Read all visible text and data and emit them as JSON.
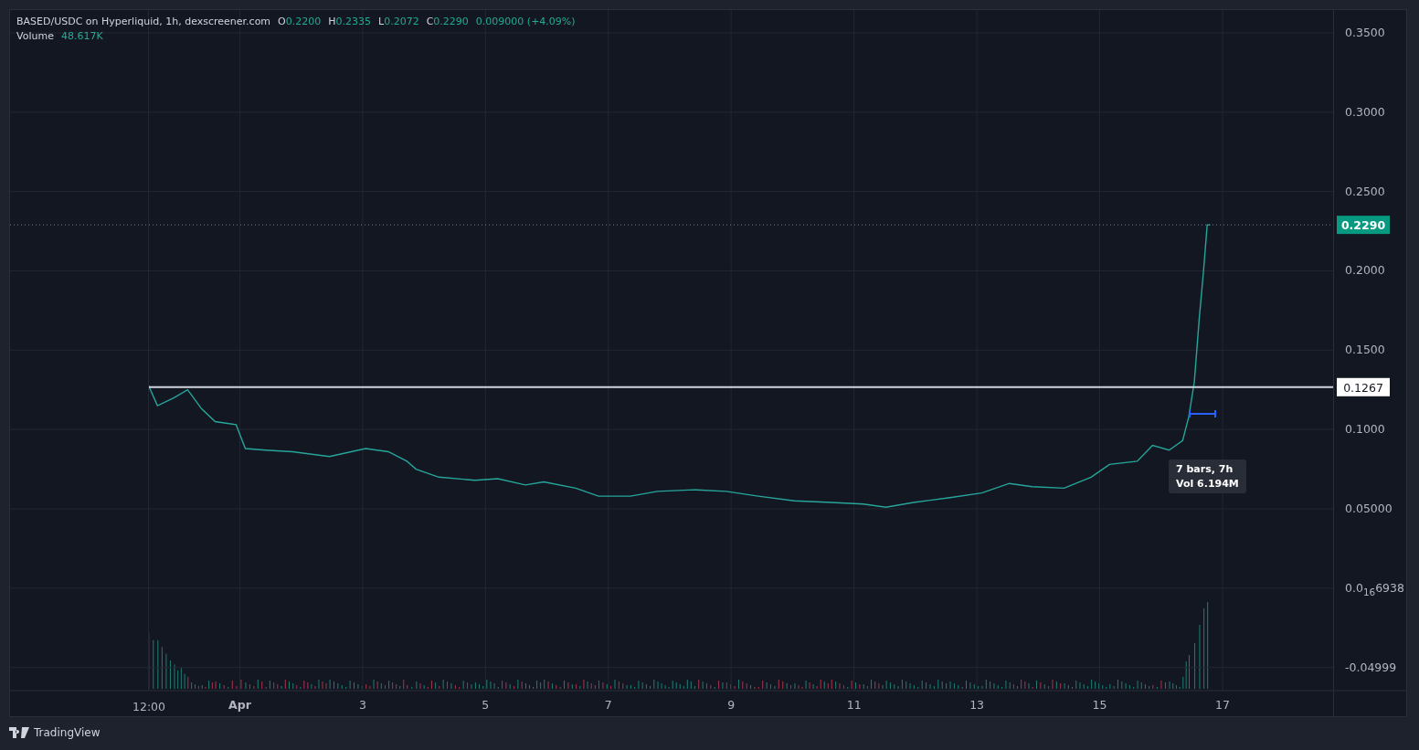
{
  "legend": {
    "title": "BASED/USDC on Hyperliquid, 1h, dexscreener.com",
    "ohlc": [
      {
        "key": "O",
        "value": "0.2200"
      },
      {
        "key": "H",
        "value": "0.2335"
      },
      {
        "key": "L",
        "value": "0.2072"
      },
      {
        "key": "C",
        "value": "0.2290"
      }
    ],
    "change": "0.009000 (+4.09%)",
    "volume_label": "Volume",
    "volume_value": "48.617K"
  },
  "chart_data": {
    "type": "line",
    "grid": true,
    "xlim": [
      -2.74,
      19.99
    ],
    "ylim": [
      -0.0646,
      0.3644
    ],
    "xticks": [
      {
        "value": 1,
        "label": "Apr"
      },
      {
        "value": 3,
        "label": "3"
      },
      {
        "value": 5,
        "label": "5"
      },
      {
        "value": 7,
        "label": "7"
      },
      {
        "value": 9,
        "label": "9"
      },
      {
        "value": 11,
        "label": "11"
      },
      {
        "value": 13,
        "label": "13"
      },
      {
        "value": 15,
        "label": "15"
      },
      {
        "value": 17,
        "label": "17"
      }
    ],
    "yticks": [
      {
        "value": 0.35,
        "label": "0.3500"
      },
      {
        "value": 0.3,
        "label": "0.3000"
      },
      {
        "value": 0.25,
        "label": "0.2500"
      },
      {
        "value": 0.2,
        "label": "0.2000"
      },
      {
        "value": 0.15,
        "label": "0.1500"
      },
      {
        "value": 0.1,
        "label": "0.1000"
      },
      {
        "value": 0.05,
        "label": "0.05000"
      },
      {
        "value": 0,
        "label": "0.0$_{16}$6938"
      },
      {
        "value": -0.04999,
        "label": "-0.04999"
      }
    ],
    "x": [
      -0.49,
      -0.34,
      -0.07,
      0.15,
      0.38,
      0.6,
      0.94,
      1.09,
      1.42,
      1.86,
      2.46,
      3.05,
      3.42,
      3.72,
      3.87,
      4.24,
      4.83,
      5.2,
      5.65,
      5.95,
      6.47,
      6.84,
      7.36,
      7.8,
      8.4,
      8.92,
      9.44,
      10.03,
      10.63,
      11.15,
      11.52,
      11.97,
      12.56,
      13.08,
      13.53,
      13.9,
      14.42,
      14.86,
      15.16,
      15.61,
      15.86,
      16.13,
      16.35,
      16.45,
      16.54,
      16.62,
      16.69,
      16.75,
      16.8
    ],
    "series": [
      {
        "color": "#26a69a",
        "values": [
          0.128,
          0.115,
          0.12,
          0.125,
          0.113,
          0.105,
          0.103,
          0.088,
          0.087,
          0.086,
          0.083,
          0.088,
          0.086,
          0.08,
          0.075,
          0.07,
          0.068,
          0.069,
          0.065,
          0.067,
          0.063,
          0.058,
          0.058,
          0.061,
          0.062,
          0.061,
          0.058,
          0.055,
          0.054,
          0.053,
          0.051,
          0.054,
          0.057,
          0.06,
          0.066,
          0.064,
          0.063,
          0.07,
          0.078,
          0.08,
          0.09,
          0.087,
          0.093,
          0.108,
          0.13,
          0.17,
          0.2,
          0.229,
          0.229
        ]
      }
    ],
    "ref_lines": [
      {
        "axis": "y",
        "value": 0.229,
        "label": "0.2290"
      },
      {
        "axis": "y",
        "value": 0.1267,
        "label": "0.1267"
      }
    ]
  },
  "time_label": "12:00",
  "measure_tooltip": {
    "lines": [
      "7 bars, 7h",
      "Vol 6.194M"
    ]
  },
  "footer": {
    "brand": "TradingView"
  }
}
